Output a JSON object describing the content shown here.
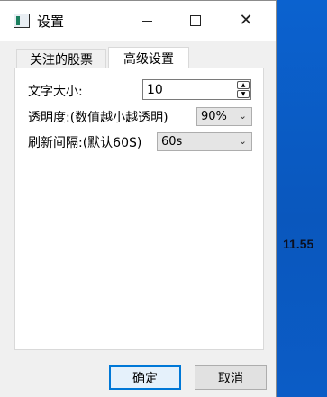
{
  "desktop": {
    "overlay_text": "11.55"
  },
  "window": {
    "title": "设置",
    "controls": {
      "minimize": "minimize",
      "maximize": "maximize",
      "close": "✕"
    }
  },
  "tabs": [
    {
      "label": "关注的股票",
      "active": false
    },
    {
      "label": "高级设置",
      "active": true
    }
  ],
  "settings": {
    "font_size_label": "文字大小:",
    "font_size_value": "10",
    "opacity_label": "透明度:(数值越小越透明)",
    "opacity_value": "90%",
    "refresh_label": "刷新间隔:(默认60S)",
    "refresh_value": "60s"
  },
  "buttons": {
    "ok": "确定",
    "cancel": "取消"
  },
  "colors": {
    "accent": "#0078d7",
    "desktop": "#0a5ac2",
    "window_bg": "#f0f0f0"
  }
}
